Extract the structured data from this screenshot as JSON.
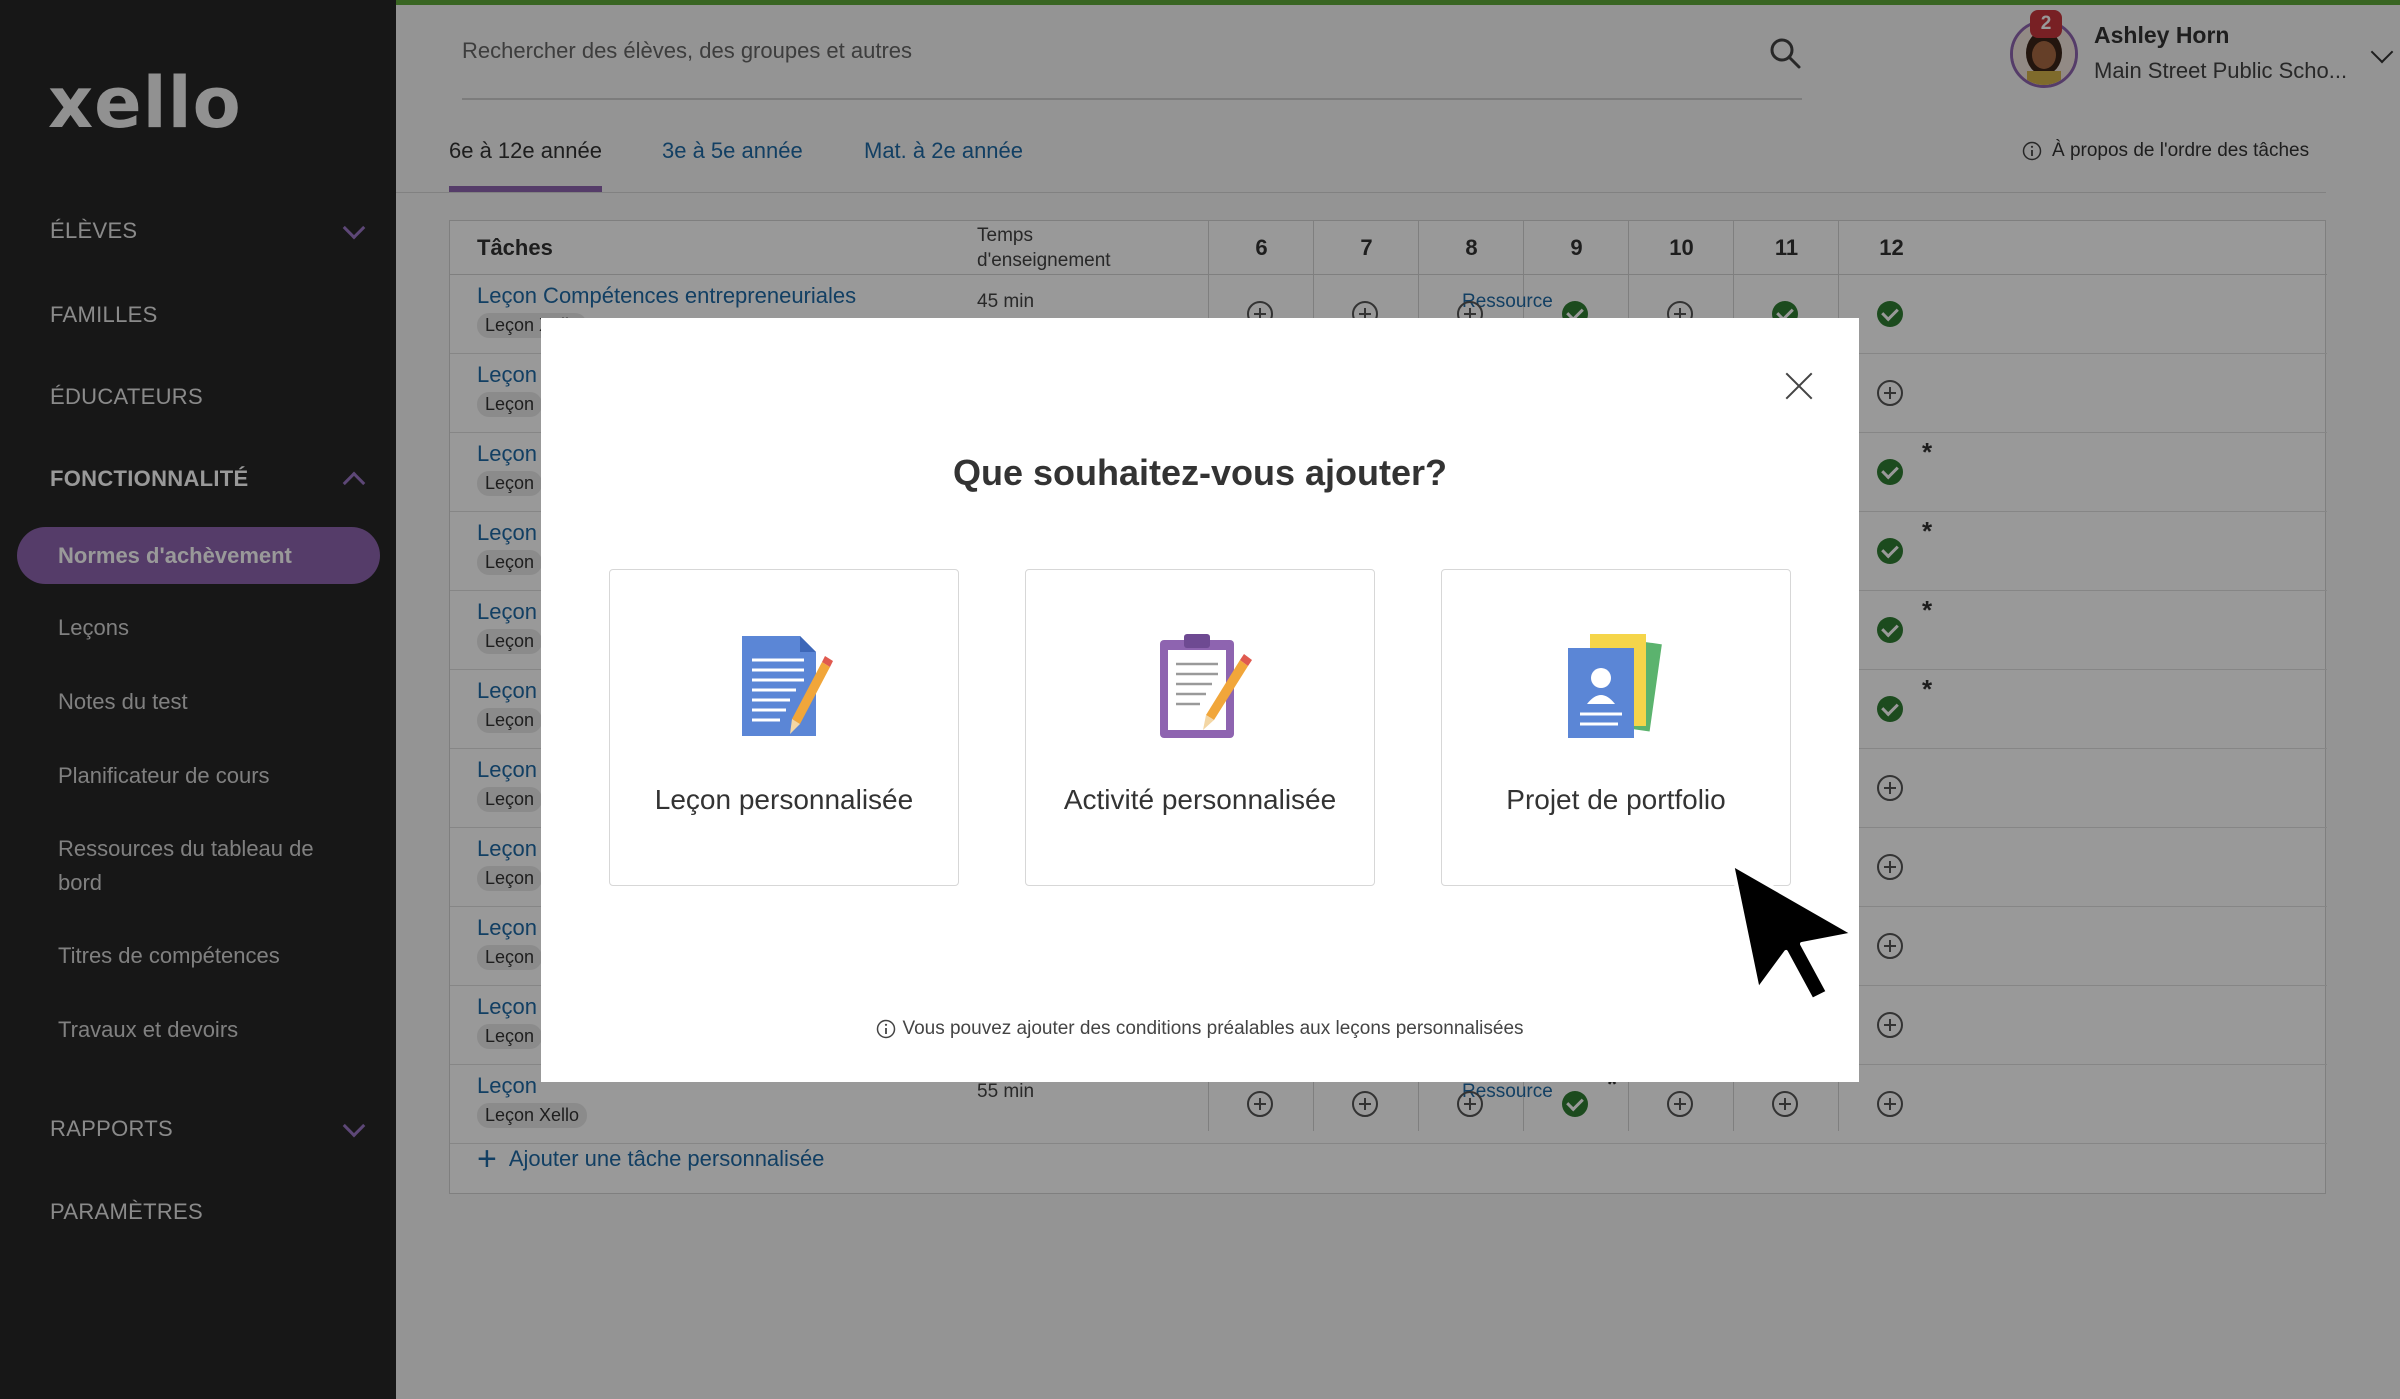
{
  "app": {
    "logo": "xello"
  },
  "sidebar": {
    "students": "ÉLÈVES",
    "families": "FAMILLES",
    "educators": "ÉDUCATEURS",
    "features": "FONCTIONNALITÉ",
    "active_item": "Normes d'achèvement",
    "sub_items": [
      "Leçons",
      "Notes du test",
      "Planificateur de cours",
      "Ressources du tableau de bord",
      "Titres de compétences",
      "Travaux et devoirs"
    ],
    "reports": "RAPPORTS",
    "settings": "PARAMÈTRES"
  },
  "header": {
    "search_placeholder": "Rechercher des élèves, des groupes et autres",
    "user_name": "Ashley Horn",
    "user_school": "Main Street Public Scho...",
    "notification_count": "2"
  },
  "tabs": {
    "items": [
      "6e à 12e année",
      "3e à 5e année",
      "Mat. à 2e année"
    ],
    "info": "À propos de l'ordre des tâches"
  },
  "table": {
    "col_tasks": "Tâches",
    "col_time_1": "Temps",
    "col_time_2": "d'enseignement",
    "grades": [
      "6",
      "7",
      "8",
      "9",
      "10",
      "11",
      "12"
    ],
    "first_row_title": "Leçon Compétences entrepreneuriales",
    "first_row_tag": "Leçon Xello",
    "first_row_time": "45 min",
    "resource": "Ressource",
    "row_prefix": "Leçon",
    "last_row_time": "55 min",
    "add_task": "Ajouter une tâche personnalisée"
  },
  "modal": {
    "title": "Que souhaitez-vous ajouter?",
    "options": [
      "Leçon personnalisée",
      "Activité personnalisée",
      "Projet de portfolio"
    ],
    "note": "Vous pouvez ajouter des conditions préalables aux leçons personnalisées"
  },
  "colors": {
    "accent": "#8e64b0",
    "sidebar": "#272727",
    "link": "#1f6aa5",
    "check": "#2f7d32",
    "topline": "#5fa83a"
  }
}
